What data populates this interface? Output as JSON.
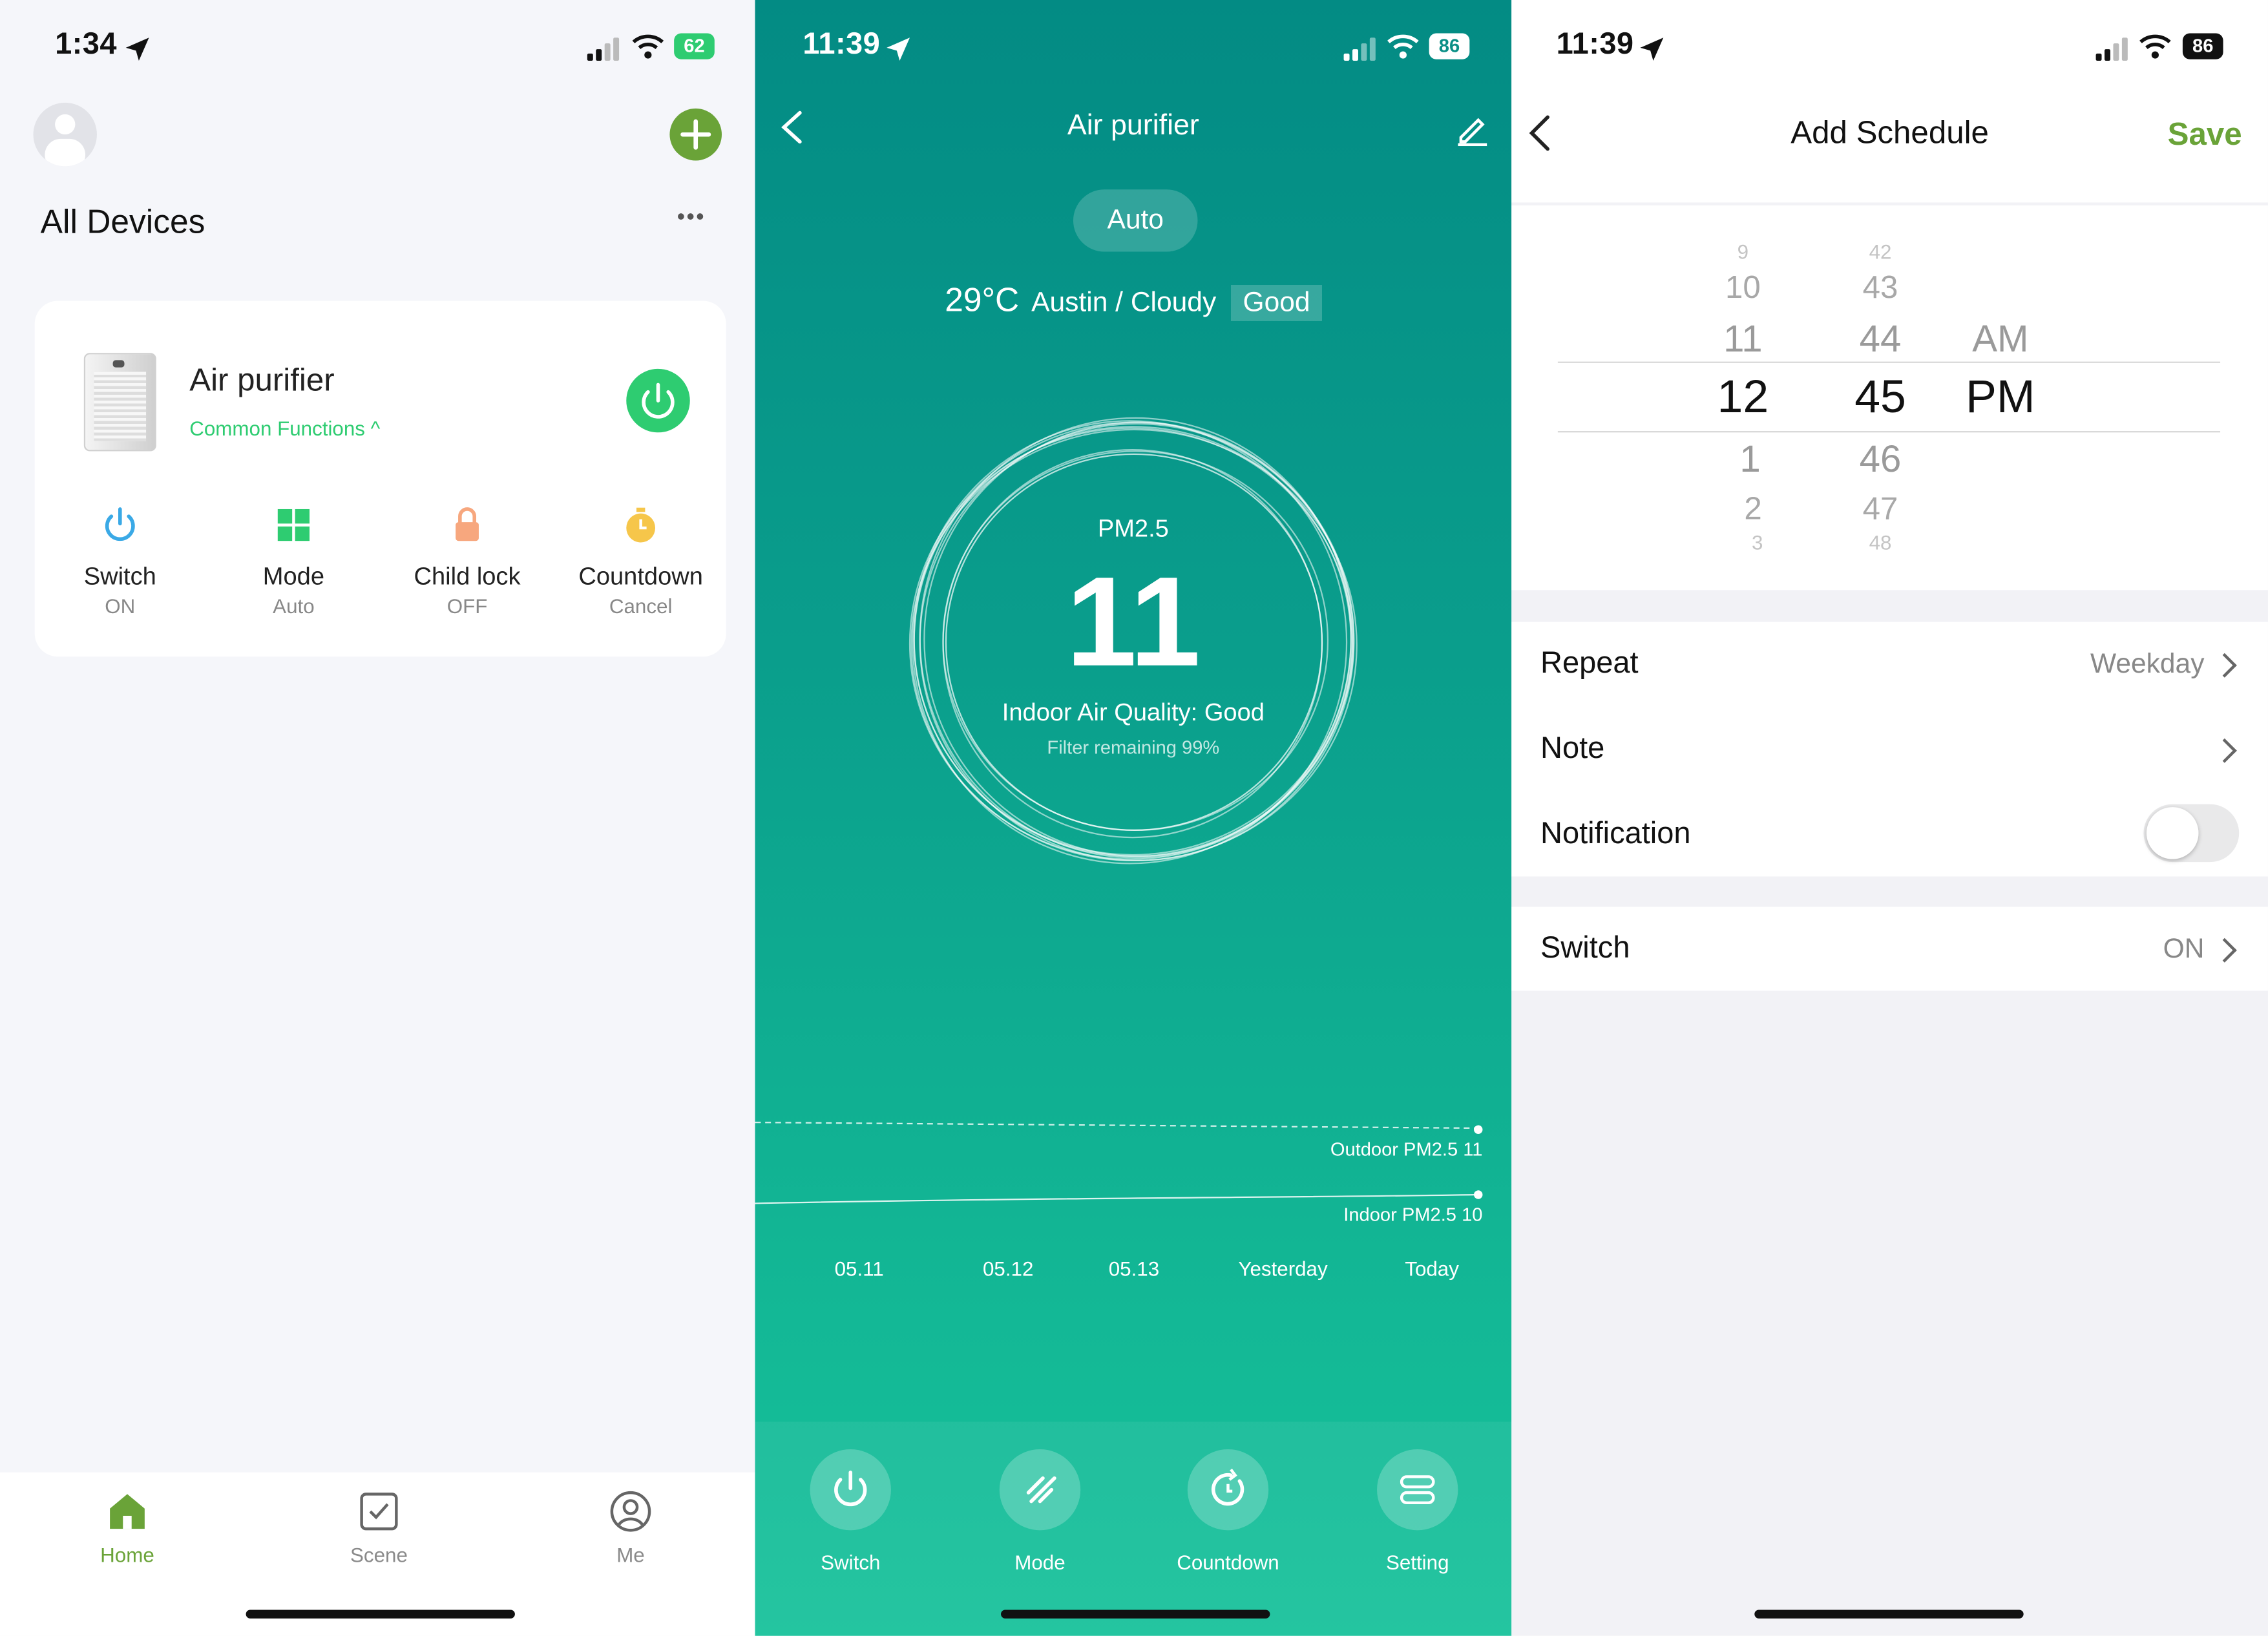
{
  "screen1": {
    "status_time": "1:34",
    "battery": "62",
    "title": "All Devices",
    "more": "•••",
    "device": {
      "name": "Air purifier",
      "link": "Common Functions ^"
    },
    "functions": [
      {
        "label": "Switch",
        "value": "ON"
      },
      {
        "label": "Mode",
        "value": "Auto"
      },
      {
        "label": "Child lock",
        "value": "OFF"
      },
      {
        "label": "Countdown",
        "value": "Cancel"
      }
    ],
    "tabs": [
      "Home",
      "Scene",
      "Me"
    ],
    "colors": {
      "accent": "#6aa338",
      "power": "#2ecc71",
      "link": "#2ecc71"
    }
  },
  "screen2": {
    "status_time": "11:39",
    "battery": "86",
    "title": "Air purifier",
    "mode_pill": "Auto",
    "weather": {
      "temp": "29°C",
      "location": "Austin / Cloudy",
      "quality": "Good"
    },
    "gauge": {
      "label": "PM2.5",
      "value": "11",
      "quality": "Indoor Air Quality: Good",
      "filter": "Filter remaining 99%"
    },
    "trend": {
      "outdoor_label": "Outdoor PM2.5 11",
      "indoor_label": "Indoor PM2.5 10",
      "dates": [
        "05.11",
        "05.12",
        "05.13",
        "Yesterday",
        "Today"
      ]
    },
    "buttons": [
      "Switch",
      "Mode",
      "Countdown",
      "Setting"
    ]
  },
  "screen3": {
    "status_time": "11:39",
    "battery": "86",
    "title": "Add Schedule",
    "save": "Save",
    "picker": {
      "hours": [
        "9",
        "10",
        "11",
        "12",
        "1",
        "2",
        "3"
      ],
      "minutes": [
        "42",
        "43",
        "44",
        "45",
        "46",
        "47",
        "48"
      ],
      "ampm": [
        "AM",
        "PM"
      ]
    },
    "repeat": {
      "label": "Repeat",
      "value": "Weekday"
    },
    "note": {
      "label": "Note"
    },
    "notification": {
      "label": "Notification"
    },
    "switch": {
      "label": "Switch",
      "value": "ON"
    }
  }
}
